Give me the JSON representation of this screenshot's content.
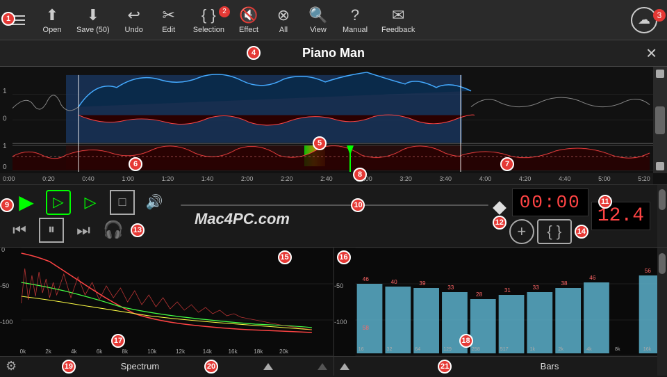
{
  "toolbar": {
    "menu_label": "☰",
    "open_label": "Open",
    "save_label": "Save (50)",
    "undo_label": "Undo",
    "edit_label": "Edit",
    "selection_label": "Selection",
    "effect_label": "Effect",
    "all_label": "All",
    "view_label": "View",
    "manual_label": "Manual",
    "feedback_label": "Feedback",
    "selection_badge": "2",
    "cloud_badge": "3"
  },
  "title_bar": {
    "title": "Piano Man",
    "annotation": "4",
    "close": "✕"
  },
  "time_ruler": {
    "marks": [
      "0:00",
      "0:20",
      "0:40",
      "1:00",
      "1:20",
      "1:40",
      "2:00",
      "2:20",
      "2:40",
      "3:00",
      "3:20",
      "3:40",
      "4:00",
      "4:20",
      "4:40",
      "5:00",
      "5:20"
    ]
  },
  "transport": {
    "play_label": "▶",
    "loop_play_label": "▷",
    "sel_play_label": "▷",
    "stop_label": "□",
    "rew_label": "⏮",
    "pause_label": "⏸",
    "ff_label": "⏭",
    "time_display": "00:00",
    "bpm_display": "12.4",
    "add_label": "+",
    "loop_label": "{ }",
    "volume_label": "🔊",
    "mac4pc": "Mac4PC.com"
  },
  "annotations": {
    "n1": "1",
    "n2": "2",
    "n3": "3",
    "n4": "4",
    "n5": "5",
    "n6": "6",
    "n7": "7",
    "n8": "8",
    "n9": "9",
    "n10": "10",
    "n11": "11",
    "n12": "12",
    "n13": "13",
    "n14": "14",
    "n15": "15",
    "n16": "16",
    "n17": "17",
    "n18": "18",
    "n19": "19",
    "n20": "20",
    "n21": "21"
  },
  "spectrum": {
    "title": "Spectrum",
    "x_labels": [
      "0k",
      "2k",
      "4k",
      "6k",
      "8k",
      "10k",
      "12k",
      "14k",
      "16k",
      "18k",
      "20k"
    ],
    "y_labels": [
      "0",
      "-50",
      "-100"
    ]
  },
  "bars": {
    "title": "Bars",
    "x_labels": [
      "16",
      "32",
      "64",
      "129",
      "258",
      "517",
      "1k",
      "2k",
      "4k",
      "8k",
      "16k"
    ],
    "y_labels": [
      "-50",
      "-100"
    ],
    "top_labels": [
      "46",
      "40",
      "39",
      "33",
      "28",
      "31",
      "33",
      "38",
      "46",
      "56"
    ],
    "bottom_labels": [
      "58",
      "",
      "",
      "",
      "",
      "",
      "",
      "",
      "",
      "",
      ""
    ],
    "bar_heights": [
      0.7,
      0.6,
      0.58,
      0.5,
      0.42,
      0.47,
      0.5,
      0.57,
      0.69,
      0.84
    ]
  }
}
